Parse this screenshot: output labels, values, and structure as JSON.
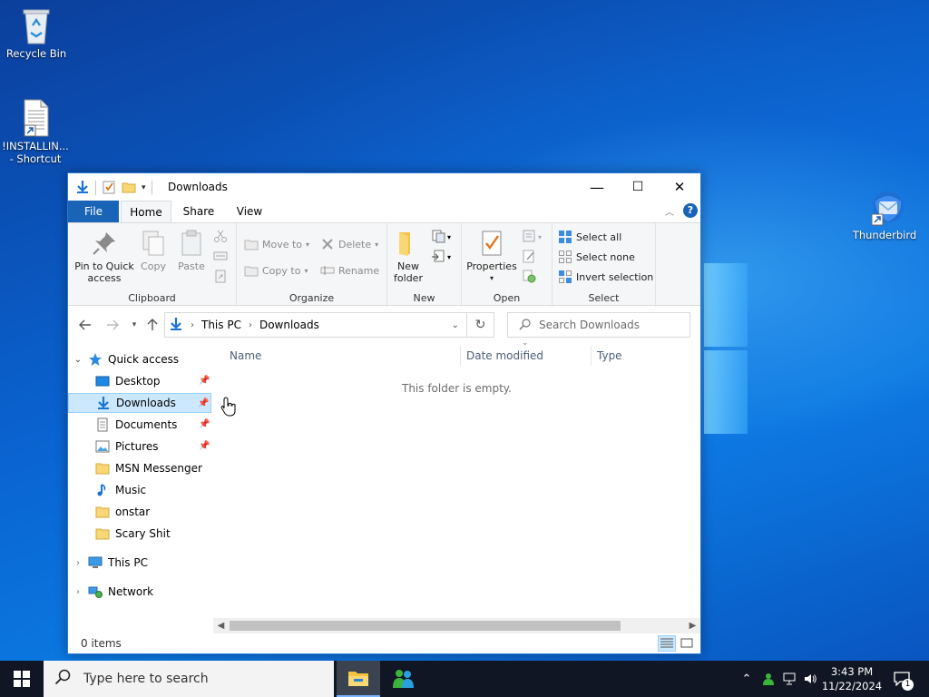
{
  "desktop": {
    "icons": [
      {
        "label": "Recycle Bin"
      },
      {
        "label": "!INSTALLIN... - Shortcut"
      },
      {
        "label": "Thunderbird"
      }
    ]
  },
  "explorer": {
    "title": "Downloads",
    "controls": {
      "minimize": "—",
      "maximize": "☐",
      "close": "✕"
    },
    "tabs": {
      "file": "File",
      "home": "Home",
      "share": "Share",
      "view": "View"
    },
    "ribbon": {
      "clipboard": {
        "label": "Clipboard",
        "pin": "Pin to Quick access",
        "copy": "Copy",
        "paste": "Paste"
      },
      "organize": {
        "label": "Organize",
        "move_to": "Move to",
        "copy_to": "Copy to",
        "delete": "Delete",
        "rename": "Rename"
      },
      "new": {
        "label": "New",
        "new_folder_line1": "New",
        "new_folder_line2": "folder"
      },
      "open": {
        "label": "Open",
        "properties": "Properties"
      },
      "select": {
        "label": "Select",
        "select_all": "Select all",
        "select_none": "Select none",
        "invert": "Invert selection"
      }
    },
    "address": {
      "crumbs": [
        "This PC",
        "Downloads"
      ],
      "search_placeholder": "Search Downloads"
    },
    "nav": {
      "quick_access": "Quick access",
      "items": [
        {
          "label": "Desktop",
          "pinned": true
        },
        {
          "label": "Downloads",
          "pinned": true,
          "selected": true
        },
        {
          "label": "Documents",
          "pinned": true
        },
        {
          "label": "Pictures",
          "pinned": true
        },
        {
          "label": "MSN Messenger",
          "pinned": false
        },
        {
          "label": "Music",
          "pinned": false
        },
        {
          "label": "onstar",
          "pinned": false
        },
        {
          "label": "Scary Shit",
          "pinned": false
        }
      ],
      "this_pc": "This PC",
      "network": "Network"
    },
    "columns": {
      "name": "Name",
      "date_modified": "Date modified",
      "type": "Type"
    },
    "empty_message": "This folder is empty.",
    "status": {
      "count": "0 items"
    }
  },
  "taskbar": {
    "search_placeholder": "Type here to search",
    "time": "3:43 PM",
    "date": "11/22/2024",
    "notification_count": "1"
  },
  "colors": {
    "accent": "#1a64b8",
    "selection": "#cce8ff",
    "taskbar": "#101623"
  }
}
